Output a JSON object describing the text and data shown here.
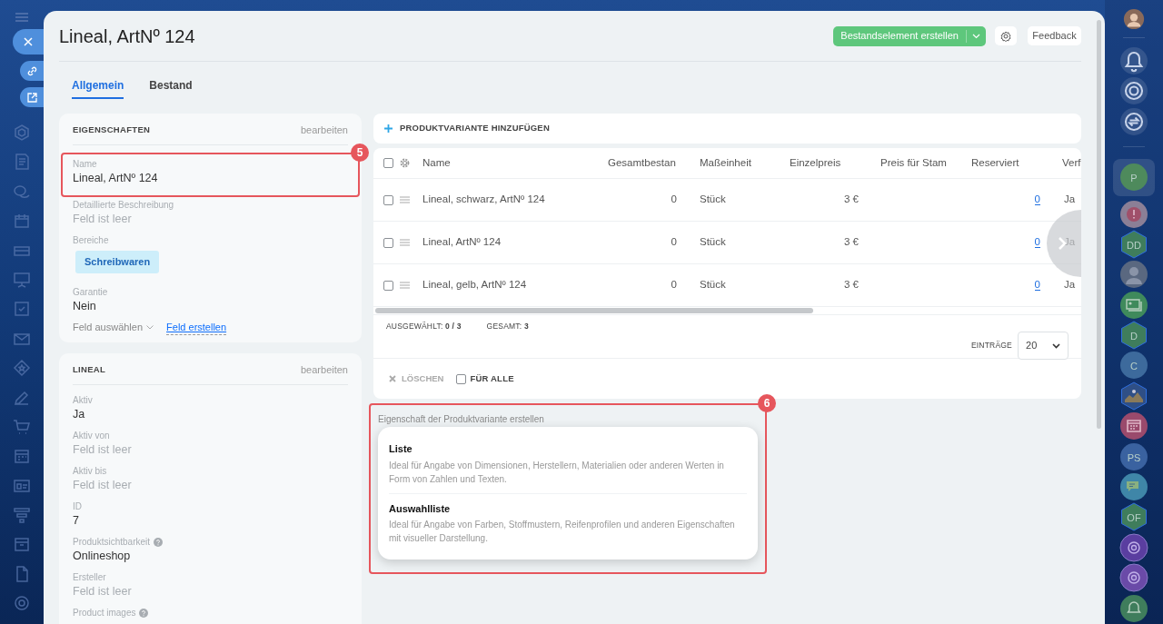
{
  "header": {
    "title": "Lineal, ArtNº 124",
    "primary_button": "Bestandselement erstellen",
    "feedback_button": "Feedback"
  },
  "tabs": [
    {
      "label": "Allgemein",
      "selected": true
    },
    {
      "label": "Bestand",
      "selected": false
    }
  ],
  "cards": [
    {
      "title": "EIGENSCHAFTEN",
      "edit_link": "bearbeiten",
      "fields": [
        {
          "kind": "text",
          "label": "Name",
          "value": "Lineal, ArtNº 124",
          "help": false,
          "annotation": "5"
        },
        {
          "kind": "text",
          "label": "Detaillierte Beschreibung",
          "placeholder": "Feld ist leer",
          "help": false
        },
        {
          "kind": "tag",
          "label": "Bereiche",
          "value": "Schreibwaren",
          "help": false
        },
        {
          "kind": "text",
          "label": "Garantie",
          "value": "Nein",
          "help": false
        }
      ],
      "footer": {
        "select": "Feld auswählen",
        "create": "Feld erstellen"
      }
    },
    {
      "title": "LINEAL",
      "edit_link": "bearbeiten",
      "fields": [
        {
          "kind": "text",
          "label": "Aktiv",
          "value": "Ja",
          "help": false
        },
        {
          "kind": "text",
          "label": "Aktiv von",
          "placeholder": "Feld ist leer",
          "help": false
        },
        {
          "kind": "text",
          "label": "Aktiv bis",
          "placeholder": "Feld ist leer",
          "help": false
        },
        {
          "kind": "text",
          "label": "ID",
          "value": "7",
          "help": false
        },
        {
          "kind": "text",
          "label": "Produktsichtbarkeit",
          "value": "Onlineshop",
          "help": true
        },
        {
          "kind": "text",
          "label": "Ersteller",
          "placeholder": "Feld ist leer",
          "help": false
        },
        {
          "kind": "text",
          "label": "Product images",
          "help": true
        }
      ]
    }
  ],
  "variants": {
    "add_button": "PRODUKTVARIANTE HINZUFÜGEN",
    "all_selected": false,
    "columns": [
      "Name",
      "Gesamtbestan",
      "Maßeinheit",
      "Einzelpreis",
      "Preis für Stam",
      "Reserviert",
      "Verf"
    ],
    "rows": [
      {
        "selected": false,
        "name": "Lineal, schwarz, ArtNº 124",
        "stock": "0",
        "unit": "Stück",
        "price": "3 €",
        "reserved": "0",
        "column_7": "Ja"
      },
      {
        "selected": false,
        "name": "Lineal, ArtNº 124",
        "stock": "0",
        "unit": "Stück",
        "price": "3 €",
        "reserved": "0",
        "column_7": "Ja"
      },
      {
        "selected": false,
        "name": "Lineal, gelb, ArtNº 124",
        "stock": "0",
        "unit": "Stück",
        "price": "3 €",
        "reserved": "0",
        "column_7": "Ja"
      }
    ],
    "summary": {
      "selected": "AUSGEWÄHLT: **0 / 3**",
      "total": "GESAMT: **3**"
    },
    "page_size": {
      "label": "EINTRÄGE",
      "value": "20"
    },
    "actions": {
      "delete": {
        "label": "LÖSCHEN",
        "disabled": true
      },
      "for_all": {
        "label": "FÜR ALLE",
        "checked": false
      }
    }
  },
  "property_menu": {
    "annotation": "6",
    "caption": "Eigenschaft der Produktvariante erstellen",
    "options": [
      {
        "title": "Liste",
        "description": "Ideal für Angabe von Dimensionen, Herstellern, Materialien oder anderen Werten in Form von Zahlen und Texten."
      },
      {
        "title": "Auswahlliste",
        "description": "Ideal für Angabe von Farben, Stoffmustern, Reifenprofilen und anderen Eigenschaften mit visueller Darstellung."
      }
    ]
  },
  "right_rail": {
    "items": [
      {
        "kind": "circle",
        "label": "P",
        "color": "#4e8a5c",
        "selected": true
      },
      {
        "kind": "alert",
        "color": "#8b7f96",
        "selected": false
      },
      {
        "kind": "hexagon",
        "label": "DD",
        "color": "#3f7d5c",
        "selected": false
      },
      {
        "kind": "person",
        "color": "#5a6880",
        "selected": false
      },
      {
        "kind": "contacts",
        "color": "#3f8a5c",
        "selected": false
      },
      {
        "kind": "hexagon",
        "label": "D",
        "color": "#3f7d5c",
        "selected": false
      },
      {
        "kind": "circle",
        "label": "C",
        "color": "#3d6a9c",
        "selected": false
      },
      {
        "kind": "badge",
        "color": "#2f4f86",
        "selected": false
      },
      {
        "kind": "calendar",
        "color": "#9a4a6c",
        "selected": false
      },
      {
        "kind": "circle",
        "label": "PS",
        "color": "#3a62a0",
        "selected": false
      },
      {
        "kind": "chat",
        "color": "#3f86a8",
        "selected": false
      },
      {
        "kind": "hexagon",
        "label": "OF",
        "color": "#3f7d5c",
        "selected": false
      },
      {
        "kind": "swirl",
        "color": "#5a3ea0",
        "selected": false
      },
      {
        "kind": "swirl",
        "color": "#6a4aa8",
        "selected": false
      },
      {
        "kind": "bell",
        "color": "#3f7d5c",
        "selected": false
      }
    ]
  }
}
